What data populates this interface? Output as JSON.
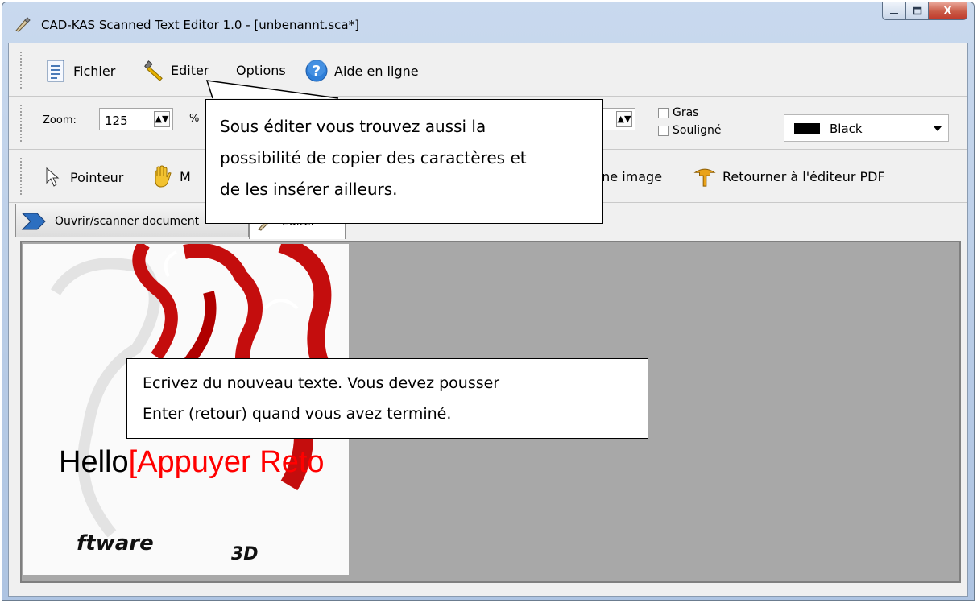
{
  "window": {
    "title": "CAD-KAS Scanned Text Editor 1.0 - [unbenannt.sca*]",
    "close_glyph": "X"
  },
  "menu": {
    "items": [
      {
        "label": "Fichier",
        "icon": "document-icon"
      },
      {
        "label": "Editer",
        "icon": "hammer-icon"
      },
      {
        "label": "Options",
        "icon": ""
      },
      {
        "label": "Aide en ligne",
        "icon": "help-icon"
      }
    ]
  },
  "format_bar": {
    "zoom_label": "Zoom:",
    "zoom_value": "125",
    "zoom_unit": "%",
    "checkboxes": [
      {
        "label": "Gras",
        "checked": false
      },
      {
        "label": "Souligné",
        "checked": false
      }
    ],
    "color": {
      "label": "Black",
      "value": "#000000"
    }
  },
  "tools": {
    "items": [
      {
        "label": "Pointeur",
        "icon": "arrow-cursor-icon"
      },
      {
        "label": "M",
        "icon": "hand-icon"
      },
      {
        "label": "une image",
        "icon": ""
      },
      {
        "label": "Retourner à l'éditeur PDF",
        "icon": "return-icon"
      }
    ]
  },
  "tabs": [
    {
      "label": "Ouvrir/scanner document",
      "active": false
    },
    {
      "label": "Editer",
      "active": true
    }
  ],
  "canvas": {
    "typed_text": "Hello",
    "prompt_text": "[Appuyer Reto",
    "logo_text_1": "ftware",
    "logo_text_2": "3D"
  },
  "callouts": {
    "top": {
      "lines": [
        "Sous éditer vous trouvez aussi la",
        "possibilité de copier des caractères et",
        "de les insérer ailleurs."
      ]
    },
    "bottom": {
      "lines": [
        "Ecrivez du nouveau texte. Vous devez pousser",
        "Enter (retour) quand vous avez terminé."
      ]
    }
  }
}
